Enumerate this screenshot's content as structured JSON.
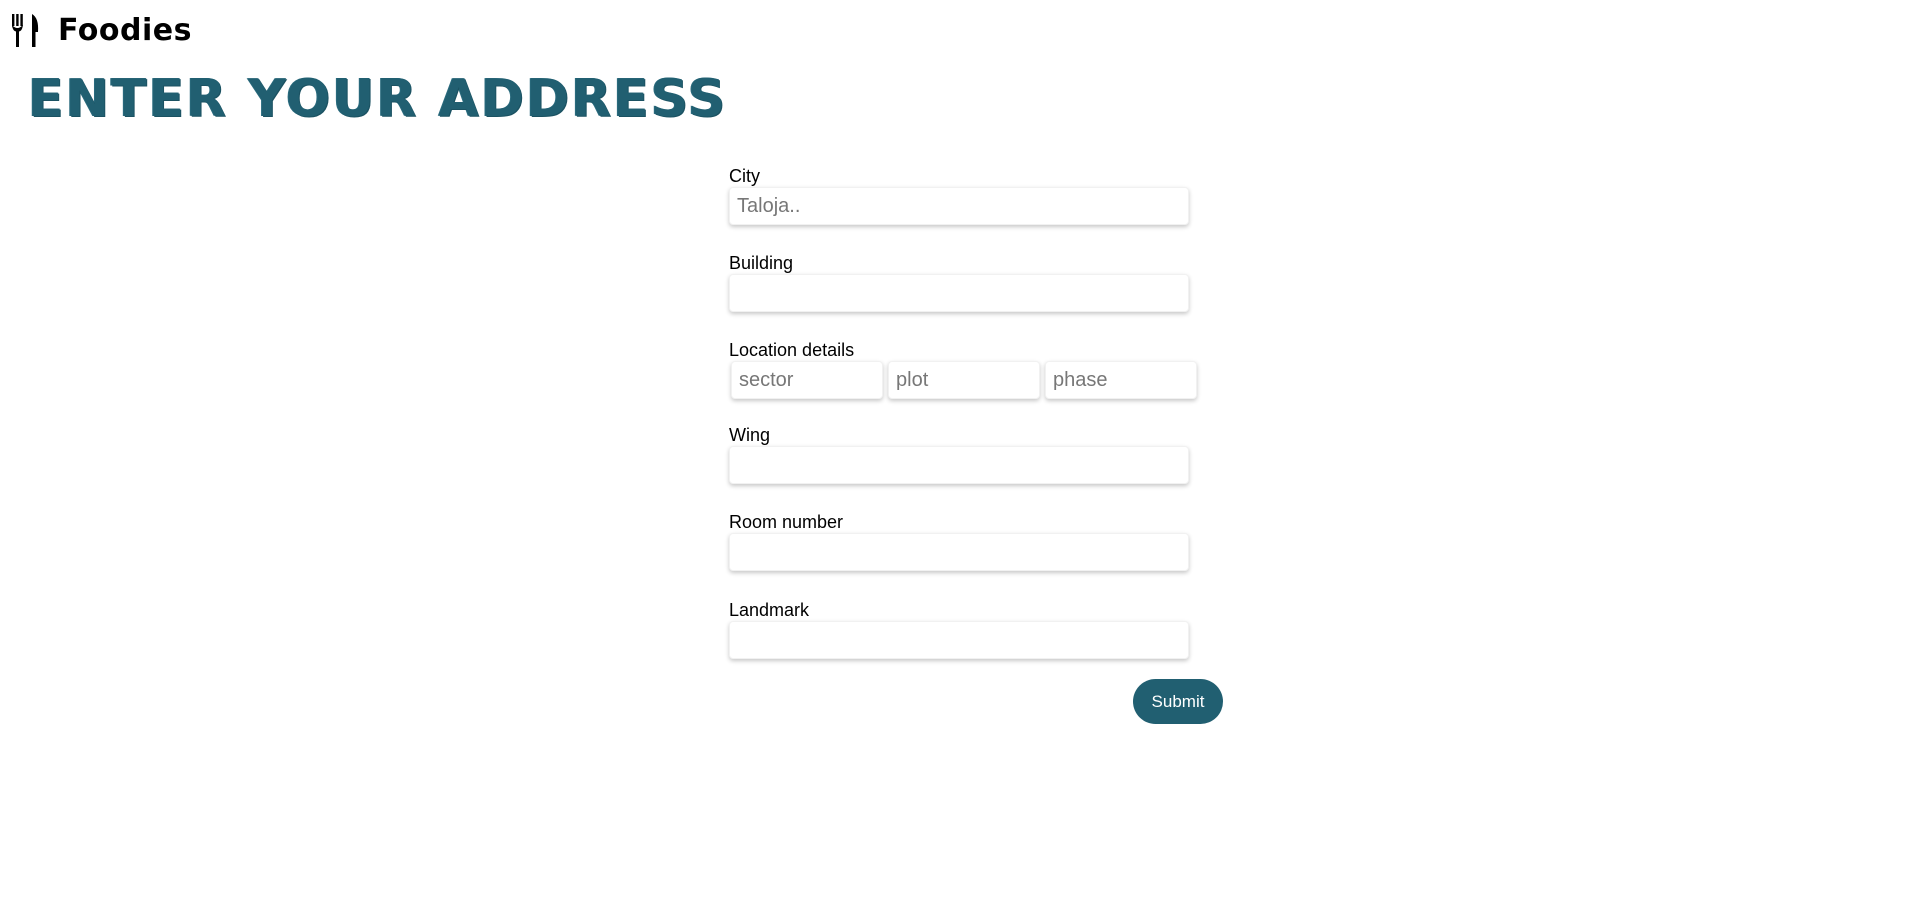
{
  "brand": {
    "icon": "fork-knife-icon",
    "name": "Foodies"
  },
  "heading": "ENTER YOUR ADDRESS",
  "form": {
    "city": {
      "label": "City",
      "placeholder": "Taloja..",
      "value": ""
    },
    "building": {
      "label": "Building",
      "placeholder": "",
      "value": ""
    },
    "location": {
      "label": "Location details",
      "sector_placeholder": "sector",
      "plot_placeholder": "plot",
      "phase_placeholder": "phase"
    },
    "wing": {
      "label": "Wing",
      "placeholder": "",
      "value": ""
    },
    "room": {
      "label": "Room number",
      "placeholder": "",
      "value": ""
    },
    "landmark": {
      "label": "Landmark",
      "placeholder": "",
      "value": ""
    },
    "submit_label": "Submit"
  },
  "colors": {
    "accent": "#215f71",
    "background": "#ffffff"
  }
}
